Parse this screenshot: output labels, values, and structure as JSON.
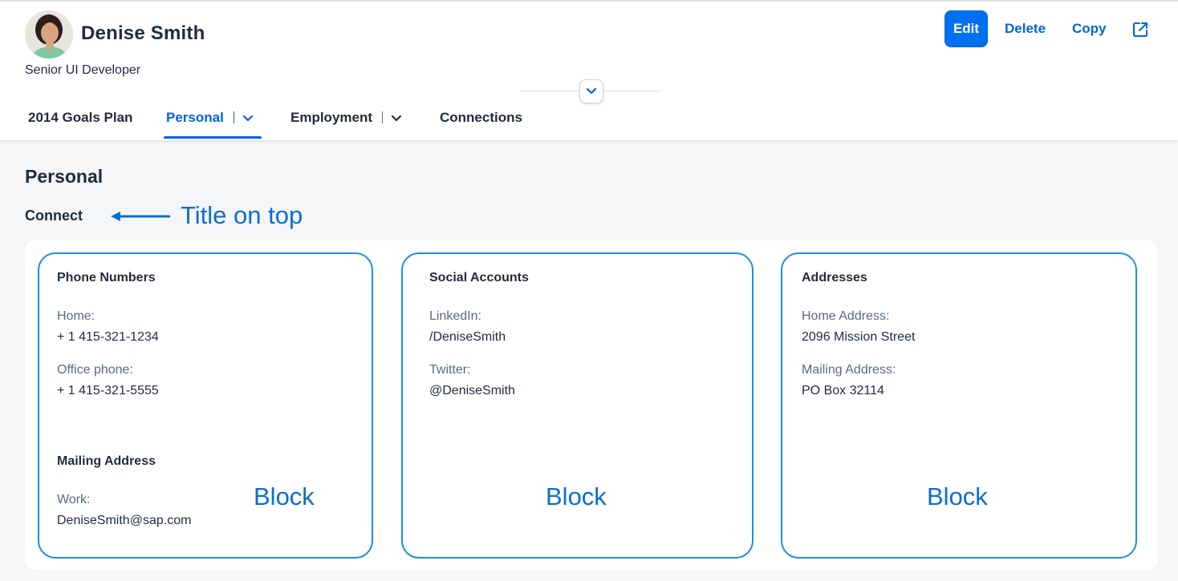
{
  "profile": {
    "name": "Denise Smith",
    "subtitle": "Senior UI Developer"
  },
  "actions": {
    "edit": "Edit",
    "delete": "Delete",
    "copy": "Copy",
    "share_icon": "share-icon"
  },
  "tabs": [
    {
      "label": "2014 Goals Plan"
    },
    {
      "label": "Personal",
      "selected": true
    },
    {
      "label": "Employment"
    },
    {
      "label": "Connections"
    }
  ],
  "section": {
    "title": "Personal",
    "subsection": "Connect"
  },
  "annotations": {
    "title_note": "Title on top",
    "block_label": "Block"
  },
  "blocks": [
    {
      "title": "Phone Numbers",
      "fields": [
        {
          "label": "Home:",
          "value": "+ 1 415-321-1234"
        },
        {
          "label": "Office phone:",
          "value": "+ 1 415-321-5555"
        }
      ],
      "group2": {
        "title": "Mailing Address",
        "fields": [
          {
            "label": "Work:",
            "value": "DeniseSmith@sap.com"
          }
        ]
      }
    },
    {
      "title": "Social Accounts",
      "fields": [
        {
          "label": "LinkedIn:",
          "value": "/DeniseSmith"
        },
        {
          "label": "Twitter:",
          "value": "@DeniseSmith"
        }
      ]
    },
    {
      "title": "Addresses",
      "fields": [
        {
          "label": "Home Address:",
          "value": "2096 Mission Street"
        },
        {
          "label": "Mailing Address:",
          "value": "PO Box 32114"
        }
      ]
    }
  ],
  "colors": {
    "accent": "#0064d9",
    "button": "#0070f2",
    "annotation": "#0a6ed1",
    "block_border": "#1a8ee8"
  }
}
